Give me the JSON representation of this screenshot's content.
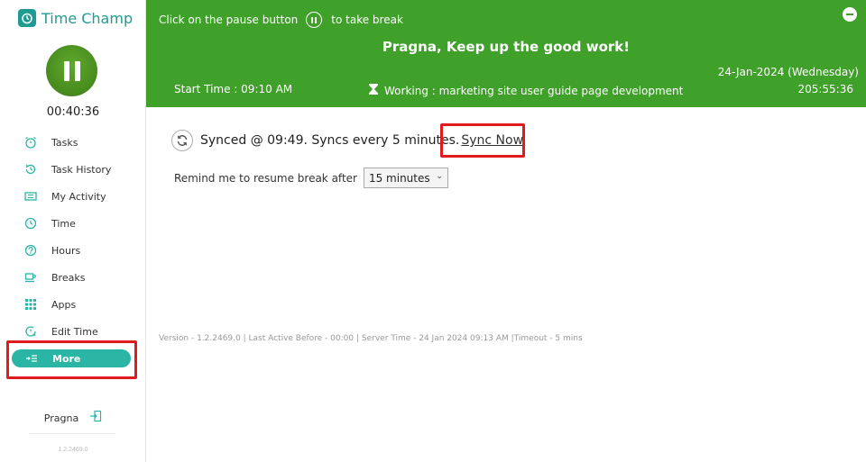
{
  "app": {
    "name": "Time Champ"
  },
  "sidebar": {
    "timer": "00:40:36",
    "items": [
      {
        "label": "Tasks",
        "icon": "alarm-clock-icon"
      },
      {
        "label": "Task History",
        "icon": "history-icon"
      },
      {
        "label": "My Activity",
        "icon": "activity-icon"
      },
      {
        "label": "Time",
        "icon": "clock-icon"
      },
      {
        "label": "Hours",
        "icon": "question-icon"
      },
      {
        "label": "Breaks",
        "icon": "coffee-icon"
      },
      {
        "label": "Apps",
        "icon": "grid-icon"
      },
      {
        "label": "Edit Time",
        "icon": "edit-time-icon"
      },
      {
        "label": "More",
        "icon": "more-icon",
        "active": true
      }
    ],
    "user": "Pragna",
    "version": "1.2.2469.0"
  },
  "header": {
    "hint_before": "Click on the pause button",
    "hint_after": "to take break",
    "greeting": "Pragna, Keep up the good work!",
    "date": "24-Jan-2024 (Wednesday)",
    "start_time": "Start Time : 09:10 AM",
    "working": "Working : marketing site user guide page development",
    "total": "205:55:36"
  },
  "main": {
    "sync_text": "Synced @ 09:49. Syncs every 5 minutes.",
    "sync_now": "Sync Now",
    "remind_label": "Remind me to resume break after",
    "remind_value": "15 minutes",
    "footer": "Version - 1.2.2469.0 | Last Active Before - 00:00 | Server Time - 24 Jan 2024 09:13 AM |Timeout - 5 mins"
  },
  "colors": {
    "accent": "#1f9c91",
    "header_green": "#3fa02a",
    "active_teal": "#2bb5a5",
    "highlight_red": "#e01b1b"
  }
}
